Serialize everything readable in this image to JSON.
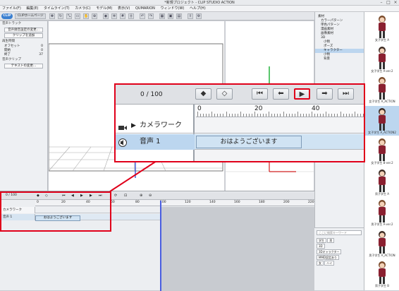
{
  "window": {
    "title": "*新規プロジェクト - CLIP STUDIO ACTION"
  },
  "menu": [
    "ファイル(F)",
    "編集(E)",
    "タイムライン(T)",
    "カメラ(C)",
    "モデル(M)",
    "表示(V)",
    "QUMARION",
    "ウィンドウ(W)",
    "ヘルプ(H)"
  ],
  "toolbar": {
    "logo": "CLIP",
    "home_label": "CLIPホームページ"
  },
  "left_panel": {
    "section1": "音声トラック",
    "btn_settings": "音声録音設定の変更...",
    "btn_add_clip": "クリップを追加",
    "section2": "再生時間",
    "rows": [
      {
        "label": "オフセット",
        "value": "0"
      },
      {
        "label": "開始",
        "value": "0"
      },
      {
        "label": "終了",
        "value": "37"
      }
    ],
    "section3": "音声クリップ",
    "btn_text": "テキストの変更..."
  },
  "right_tree": [
    {
      "label": "素材",
      "sel": false
    },
    {
      "label": "カラーパターン",
      "sel": false
    },
    {
      "label": "単色パターン",
      "sel": false
    },
    {
      "label": "漫画素材",
      "sel": false
    },
    {
      "label": "画像素材",
      "sel": false
    },
    {
      "label": "3D",
      "sel": false
    },
    {
      "label": "小物",
      "sel": false
    },
    {
      "label": "ポーズ",
      "sel": false
    },
    {
      "label": "キャラクター",
      "sel": true
    },
    {
      "label": "小物",
      "sel": false
    },
    {
      "label": "背景",
      "sel": false
    }
  ],
  "thumbnails": [
    {
      "label": "女子学生 A",
      "sel": false
    },
    {
      "label": "女子学生 A-ver.2",
      "sel": false
    },
    {
      "label": "女子学生 A_ACTION",
      "sel": false
    },
    {
      "label": "女子学生 A_ACTION2",
      "sel": true
    },
    {
      "label": "女子学生 B-ver.2",
      "sel": false
    },
    {
      "label": "男子学生 A",
      "sel": false
    },
    {
      "label": "男子学生 A-ver.2",
      "sel": false
    },
    {
      "label": "男子学生 A_ACTION",
      "sel": false
    },
    {
      "label": "男子学生 B",
      "sel": false
    }
  ],
  "search": {
    "placeholder": "ここに検索キーワード",
    "tags": [
      "学生",
      "男",
      "3D",
      "3Dキャラクター",
      "MMD設定あり",
      "女",
      "ハイ"
    ]
  },
  "timeline": {
    "frame": "0 / 100",
    "ruler": [
      "0",
      "20",
      "40",
      "60",
      "80",
      "100",
      "120",
      "140",
      "160",
      "180",
      "200",
      "220"
    ],
    "tracks": [
      {
        "name": "カメラワーク"
      },
      {
        "name": "音声 1"
      }
    ],
    "clip_text": "おはようございます"
  },
  "zoom": {
    "frame": "0 / 100",
    "ruler": [
      "0",
      "20",
      "40"
    ],
    "tracks": [
      {
        "name": "カメラワーク"
      },
      {
        "name": "音声 1"
      }
    ],
    "clip_text": "おはようございます",
    "buttons": {
      "diamond_add": "◆",
      "diamond_del": "◇",
      "first": "⏮",
      "prev": "⬅",
      "play": "▶",
      "next": "➡",
      "last": "⏭"
    }
  }
}
